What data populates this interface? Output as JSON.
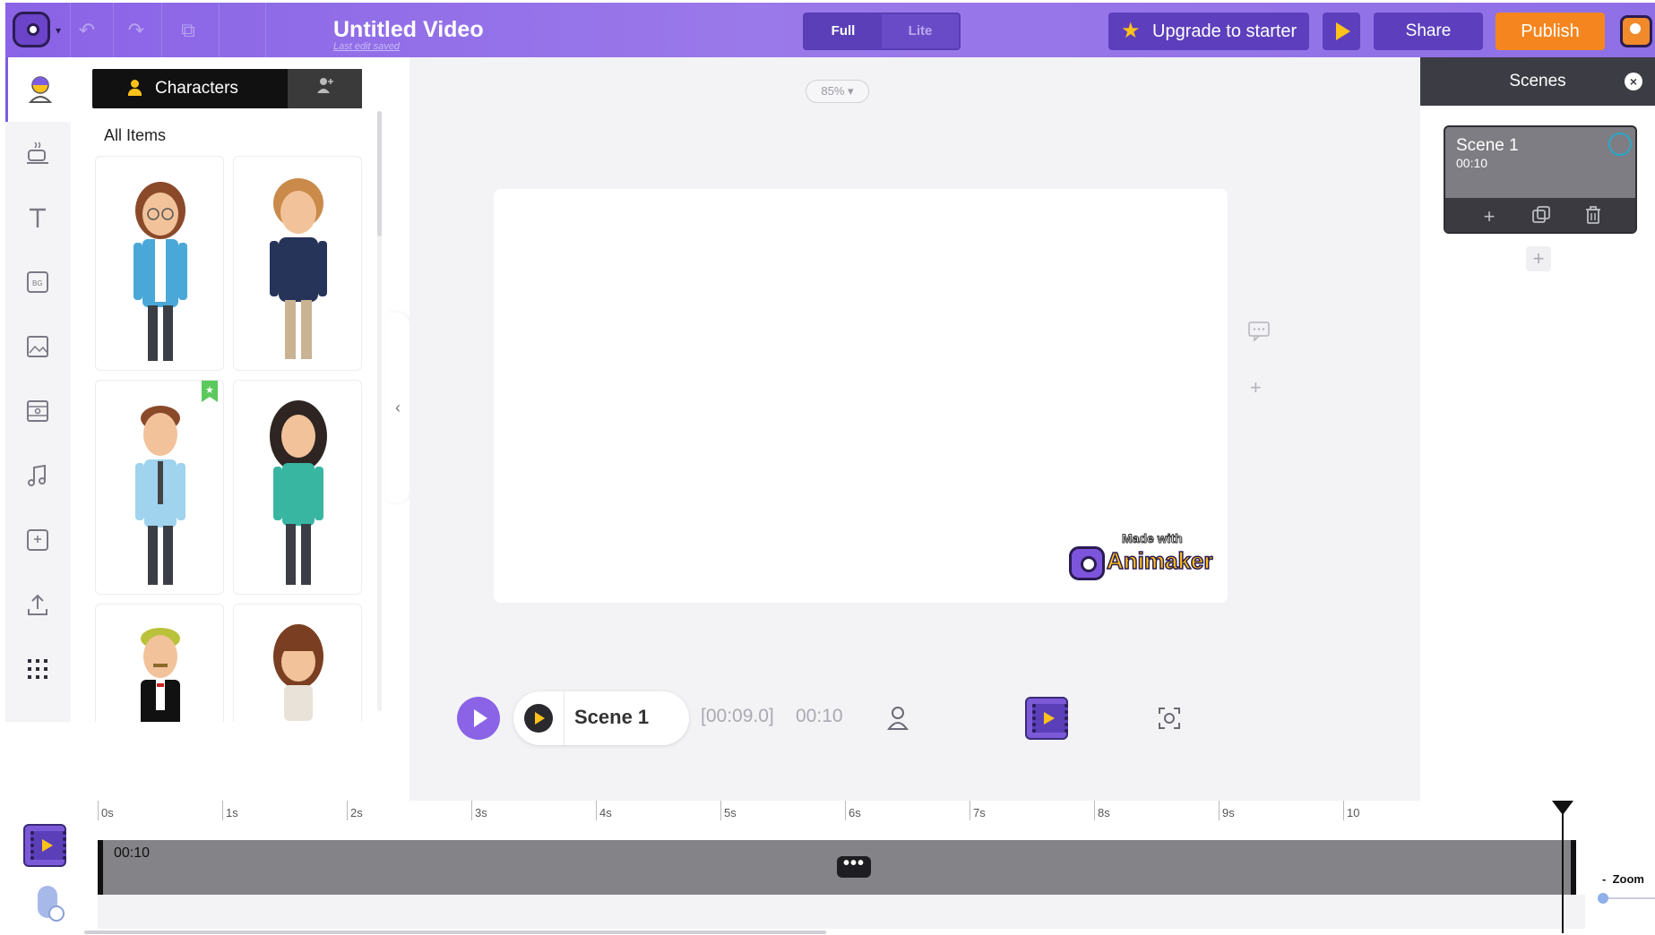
{
  "header": {
    "title": "Untitled Video",
    "subtitle": "Last edit saved",
    "mode_full": "Full",
    "mode_lite": "Lite",
    "upgrade_label": "Upgrade to starter",
    "share_label": "Share",
    "publish_label": "Publish"
  },
  "rail": {
    "items": [
      "character",
      "properties",
      "text",
      "background",
      "image",
      "video",
      "music",
      "effects",
      "upload",
      "more"
    ],
    "bg_badge": "BG"
  },
  "panel": {
    "tab_label": "Characters",
    "section_label": "All Items"
  },
  "stage": {
    "zoom": "85%",
    "watermark_top": "Made with",
    "watermark_brand": "Animaker"
  },
  "playback": {
    "scene_name": "Scene 1",
    "current_time": "[00:09.0]",
    "duration": "00:10"
  },
  "scenes": {
    "header": "Scenes",
    "list": [
      {
        "name": "Scene 1",
        "duration": "00:10"
      }
    ]
  },
  "timeline": {
    "ticks": [
      "0s",
      "1s",
      "2s",
      "3s",
      "4s",
      "5s",
      "6s",
      "7s",
      "8s",
      "9s",
      "10"
    ],
    "track_duration": "00:10",
    "zoom_label": "Zoom",
    "zoom_minus": "-"
  },
  "colors": {
    "accent": "#8a63e6",
    "publish": "#f5861f",
    "star": "#ffc21a"
  }
}
